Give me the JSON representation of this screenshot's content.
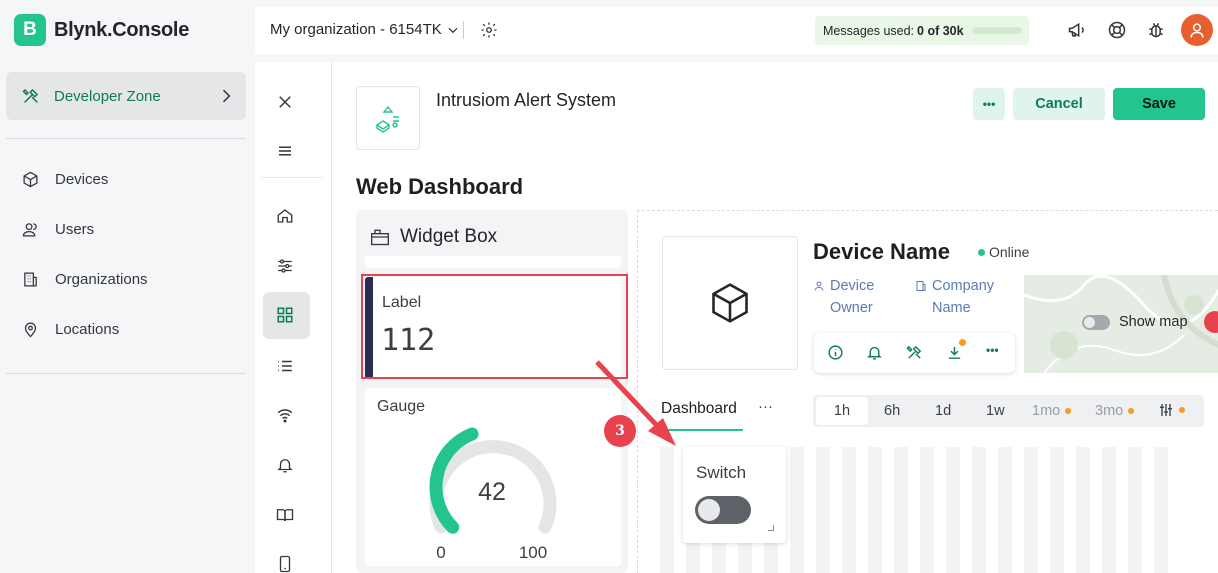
{
  "app": {
    "logo_letter": "B",
    "name": "Blynk.Console"
  },
  "sidebar": {
    "active_item": "Developer Zone",
    "items": [
      {
        "label": "Devices",
        "icon": "cube-icon"
      },
      {
        "label": "Users",
        "icon": "users-icon"
      },
      {
        "label": "Organizations",
        "icon": "building-icon"
      },
      {
        "label": "Locations",
        "icon": "location-pin-icon"
      }
    ]
  },
  "header": {
    "organization": "My organization - 6154TK",
    "messages_label": "Messages used:",
    "messages_value": "0 of 30k",
    "messages_used_fraction": 0
  },
  "template": {
    "name": "Intrusiom Alert System",
    "more_label": "•••",
    "cancel_label": "Cancel",
    "save_label": "Save"
  },
  "page_title": "Web Dashboard",
  "widget_box": {
    "title": "Widget Box",
    "label_widget": {
      "title": "Label",
      "value": "112"
    },
    "gauge_widget": {
      "title": "Gauge",
      "value": "42",
      "min": "0",
      "max": "100",
      "level": 0.42
    }
  },
  "device": {
    "name": "Device Name",
    "status": "Online",
    "owner_label": [
      "Device",
      "Owner"
    ],
    "company_label": [
      "Company",
      "Name"
    ],
    "show_map_label": "Show map"
  },
  "tabs": {
    "dashboard": "Dashboard",
    "more": "···"
  },
  "time_ranges": [
    {
      "label": "1h",
      "active": true,
      "locked": false
    },
    {
      "label": "6h",
      "active": false,
      "locked": false
    },
    {
      "label": "1d",
      "active": false,
      "locked": false
    },
    {
      "label": "1w",
      "active": false,
      "locked": false
    },
    {
      "label": "1mo",
      "active": false,
      "locked": true
    },
    {
      "label": "3mo",
      "active": false,
      "locked": true
    }
  ],
  "switch_widget": {
    "title": "Switch",
    "on": false
  },
  "annotation": {
    "step": "3"
  },
  "colors": {
    "accent": "#23c48e",
    "highlight": "#e8424f",
    "link": "#5b7bb5"
  }
}
